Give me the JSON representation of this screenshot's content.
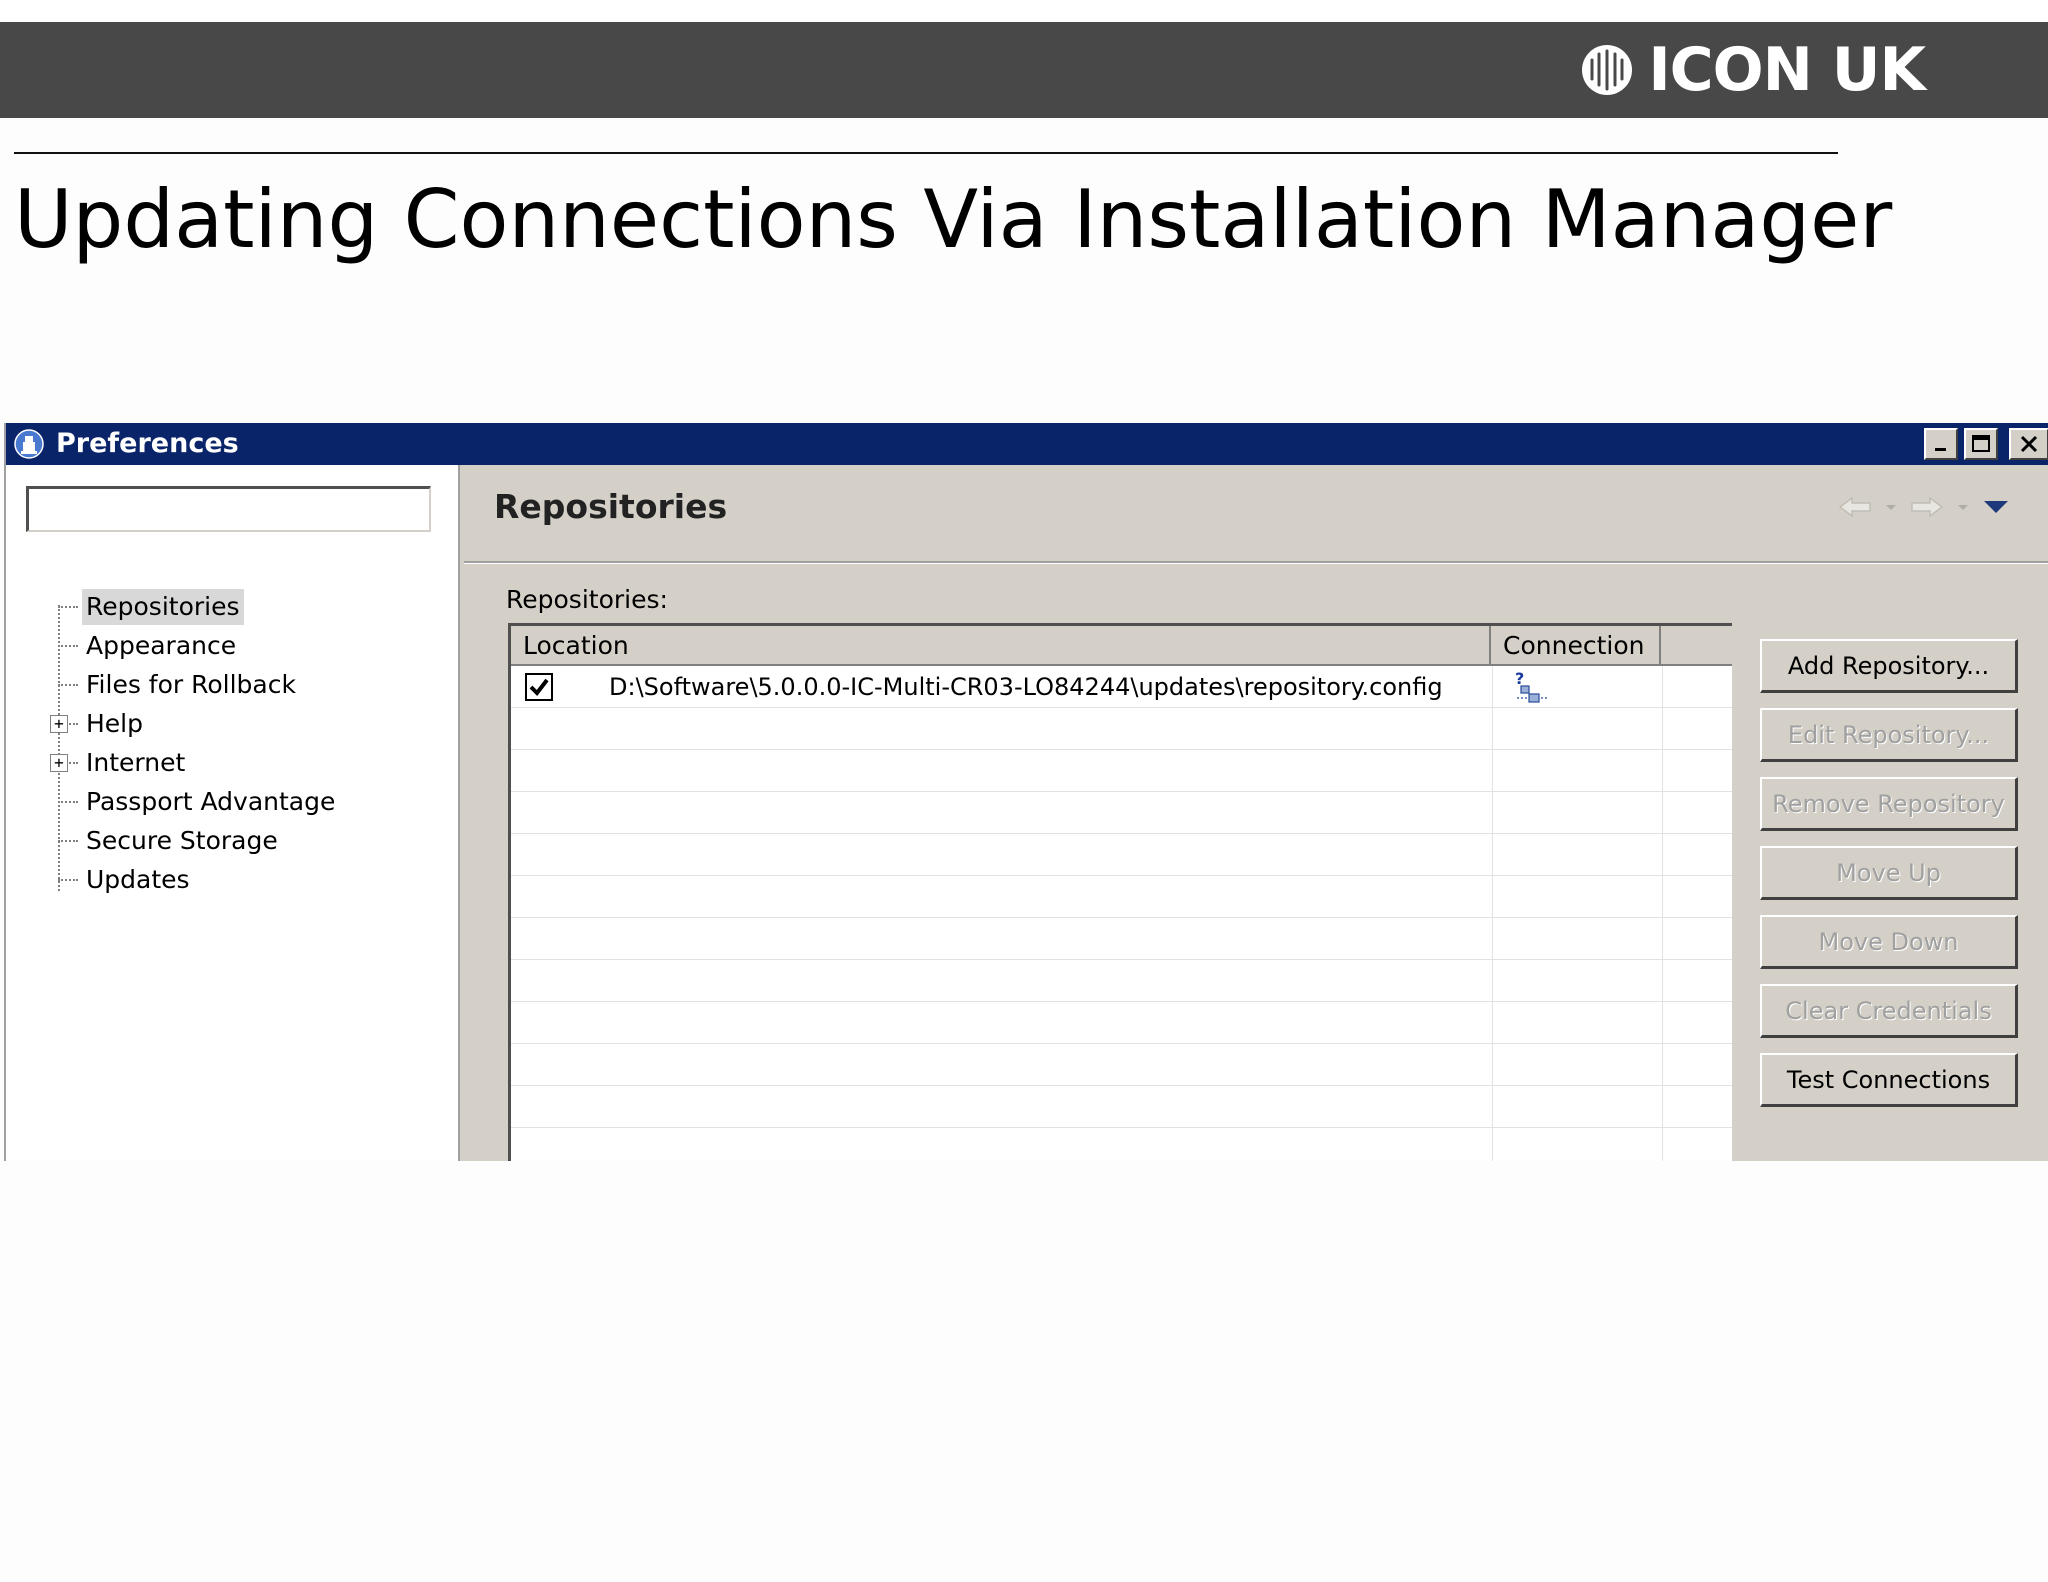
{
  "slide": {
    "brand": "ICON UK",
    "title": "Updating Connections Via Installation Manager"
  },
  "window": {
    "title": "Preferences"
  },
  "sidebar": {
    "filter_value": "",
    "items": [
      {
        "label": "Repositories"
      },
      {
        "label": "Appearance"
      },
      {
        "label": "Files for Rollback"
      },
      {
        "label": "Help"
      },
      {
        "label": "Internet"
      },
      {
        "label": "Passport Advantage"
      },
      {
        "label": "Secure Storage"
      },
      {
        "label": "Updates"
      }
    ]
  },
  "main": {
    "page_title": "Repositories",
    "section_label": "Repositories:",
    "table": {
      "columns": [
        "Location",
        "Connection"
      ],
      "rows": [
        {
          "location": "D:\\Software\\5.0.0.0-IC-Multi-CR03-LO84244\\updates\\repository.config",
          "connection_icon": "connection-unknown-icon"
        }
      ]
    },
    "buttons": {
      "add": "Add Repository...",
      "edit": "Edit Repository...",
      "remove": "Remove Repository",
      "move_up": "Move Up",
      "move_down": "Move Down",
      "clear": "Clear Credentials",
      "test": "Test Connections"
    }
  },
  "colors": {
    "banner": "#484848",
    "titlebar": "#0a246a",
    "dialog_bg": "#d4d0c8"
  }
}
